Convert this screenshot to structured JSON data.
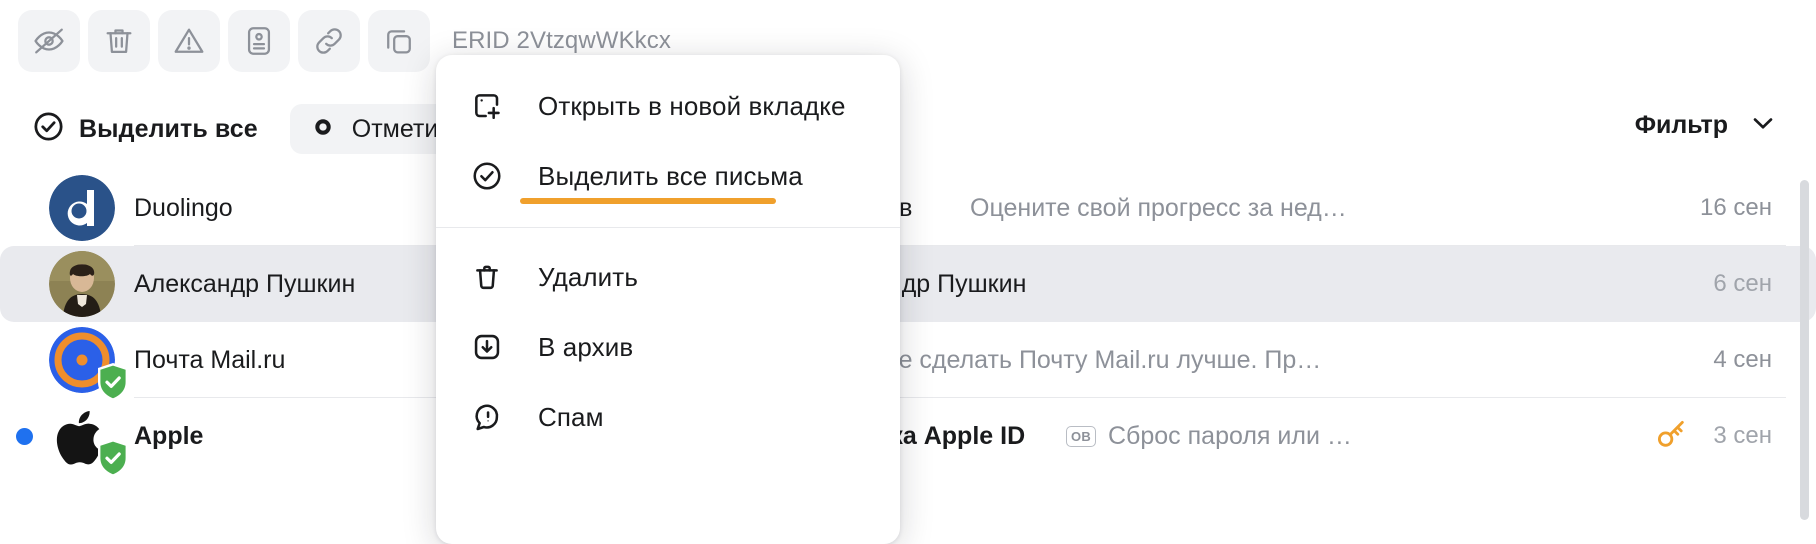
{
  "toolbar": {
    "buttons": [
      {
        "name": "eye-off-icon",
        "label": "Скрыть"
      },
      {
        "name": "trash-icon",
        "label": "Удалить"
      },
      {
        "name": "warning-icon",
        "label": "Спам"
      },
      {
        "name": "contact-card-icon",
        "label": "Контакт"
      },
      {
        "name": "link-icon",
        "label": "Ссылка"
      },
      {
        "name": "copy-icon",
        "label": "Копировать"
      }
    ],
    "erid_label": "ERID 2VtzqwWKkcx"
  },
  "selection_bar": {
    "select_all_label": "Выделить все",
    "select_all_icon": "check-circle-icon",
    "mark_label": "Отметить",
    "mark_icon": "unread-dot-icon",
    "filter_label": "Фильтр",
    "filter_icon": "chevron-down-icon"
  },
  "messages": [
    {
      "sender": "Duolingo",
      "subject": "тов",
      "snippet": "Оцените свой прогресс за нед…",
      "date": "16 сен",
      "unread": false,
      "selected": false,
      "verified": false,
      "avatar": "duolingo-logo"
    },
    {
      "sender": "Александр Пушкин",
      "subject": "андр Пушкин",
      "snippet": "",
      "date": "6 сен",
      "unread": false,
      "selected": true,
      "verified": false,
      "avatar": "pushkin-portrait"
    },
    {
      "sender": "Почта Mail.ru",
      "subject": "",
      "snippet": "тите сделать Почту Mail.ru лучше. Пр…",
      "date": "4 сен",
      "unread": false,
      "selected": false,
      "verified": true,
      "avatar": "mailru-logo"
    },
    {
      "sender": "Apple",
      "subject": "вка Apple ID",
      "snippet": "Сброс пароля или …",
      "badge": "ОВ",
      "date": "3 сен",
      "unread": true,
      "selected": false,
      "verified": true,
      "avatar": "apple-logo",
      "attachment_icon": "key-icon"
    }
  ],
  "context_menu": {
    "items": [
      {
        "label": "Открыть в новой вкладке",
        "icon": "open-new-tab-icon",
        "highlighted": false
      },
      {
        "label": "Выделить все письма",
        "icon": "check-circle-icon",
        "highlighted": true
      },
      {
        "label": "Удалить",
        "icon": "trash-icon",
        "highlighted": false
      },
      {
        "label": "В архив",
        "icon": "archive-icon",
        "highlighted": false
      },
      {
        "label": "Спам",
        "icon": "spam-icon",
        "highlighted": false
      }
    ]
  },
  "colors": {
    "accent_orange": "#f0a02c",
    "unread_blue": "#1f71ef",
    "verified_green": "#4caf50",
    "text_primary": "#1a1b1d",
    "text_muted": "#8d9199",
    "surface_gray": "#f2f3f5",
    "selected_row": "#e9eaee"
  }
}
